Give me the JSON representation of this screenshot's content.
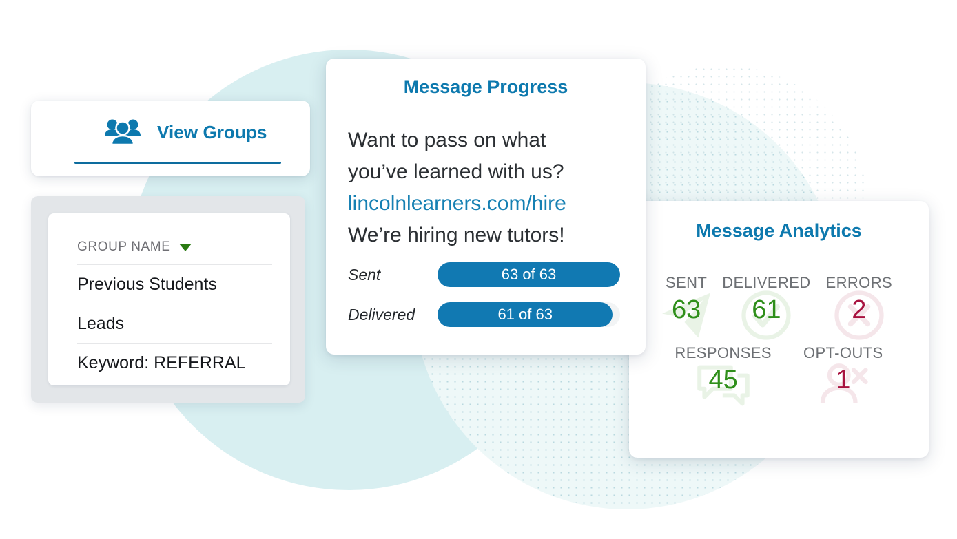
{
  "colors": {
    "brand_blue": "#0d79ae",
    "bar_blue": "#1179b2",
    "green": "#2f8f1a",
    "crimson": "#a8123f",
    "sort_green": "#2a7a12",
    "circle_teal": "#d6eef0"
  },
  "view_groups": {
    "icon": "group-people-icon",
    "label": "View Groups"
  },
  "group_list": {
    "header_label": "GROUP NAME",
    "sort_icon": "caret-down-icon",
    "rows": [
      "Previous Students",
      "Leads",
      "Keyword: REFERRAL"
    ]
  },
  "message_progress": {
    "title": "Message Progress",
    "message_lines": [
      "Want to pass on what",
      "you’ve learned with us?"
    ],
    "link": "lincolnlearners.com/hire",
    "closing_line": "We’re hiring new tutors!",
    "bars": [
      {
        "label": "Sent",
        "text": "63 of 63",
        "value": 63,
        "total": 63,
        "percent": 100
      },
      {
        "label": "Delivered",
        "text": "61 of 63",
        "value": 61,
        "total": 63,
        "percent": 96
      }
    ]
  },
  "message_analytics": {
    "title": "Message Analytics",
    "row1": [
      {
        "label": "SENT",
        "value": "63",
        "tone": "green",
        "watermark": "paper-plane-icon"
      },
      {
        "label": "DELIVERED",
        "value": "61",
        "tone": "green",
        "watermark": "check-badge-icon"
      },
      {
        "label": "ERRORS",
        "value": "2",
        "tone": "red",
        "watermark": "error-cross-icon"
      }
    ],
    "row2": [
      {
        "label": "RESPONSES",
        "value": "45",
        "tone": "green",
        "watermark": "chat-bubbles-icon"
      },
      {
        "label": "OPT-OUTS",
        "value": "1",
        "tone": "red",
        "watermark": "person-remove-icon"
      }
    ]
  }
}
